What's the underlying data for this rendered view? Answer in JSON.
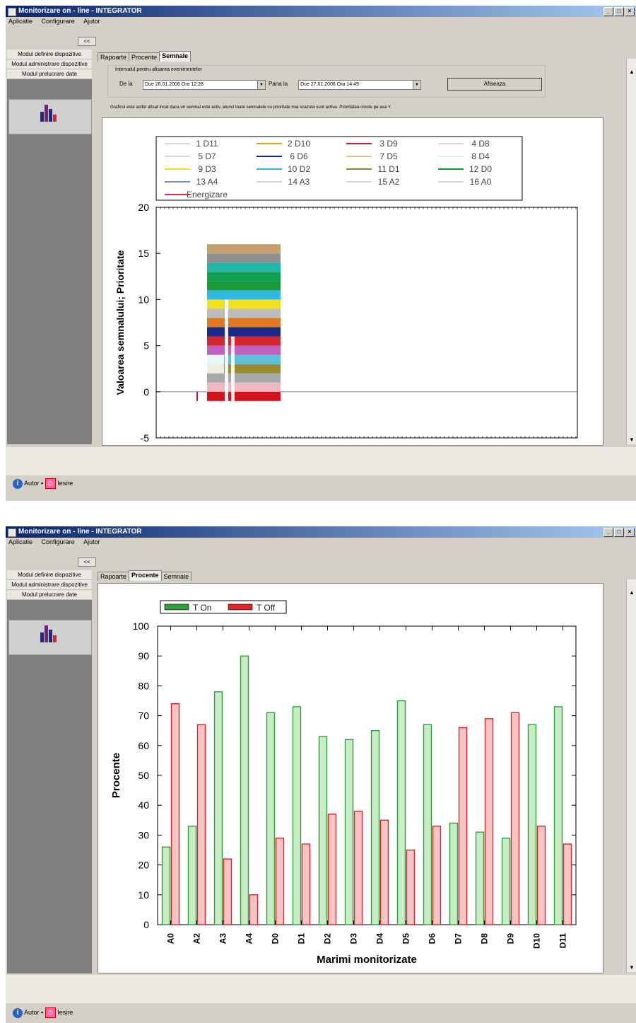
{
  "window": {
    "title": "Monitorizare on - line - INTEGRATOR",
    "menu": [
      "Aplicatie",
      "Configurare",
      "Ajutor"
    ],
    "collapse_label": "<<"
  },
  "sidebar": {
    "items": [
      "Modul definire dispozitive",
      "Modul administrare dispozitive",
      "Modul prelucrare date"
    ]
  },
  "tabs": [
    "Rapoarte",
    "Procente",
    "Semnale"
  ],
  "statusbar": {
    "help_label": "Autor",
    "exit_label": "Iesire"
  },
  "screen1": {
    "active_tab": "Semnale",
    "filter": {
      "group_label": "Intervalul pentru afisarea evenimentelor",
      "from_label": "De la",
      "from_value": "Due 26.01.2006 Ora 12:28",
      "to_label": "Pana la",
      "to_value": "Due 27.01.2006 Ora 14:49",
      "button_label": "Afiseaza"
    },
    "note": "Graficul este astfel afisat incat daca un semnal este activ, atunci toate semnalele cu prioritate mai scazuta sunt active. Prioritatea creste pe axa Y."
  },
  "screen2": {
    "active_tab": "Procente"
  },
  "colors": {
    "title_start": "#0a246a",
    "title_end": "#a6caf0",
    "on": "#2e9e3e",
    "off": "#d8262b"
  },
  "chart_data": [
    {
      "type": "bar",
      "ylabel": "Valoarea semnalului; Prioritate",
      "ylim": [
        -5,
        20
      ],
      "yticks": [
        -5,
        0,
        5,
        10,
        15,
        20
      ],
      "legend": [
        {
          "name": "1 D11",
          "color": "#d8d8d8"
        },
        {
          "name": "2 D10",
          "color": "#e8a020"
        },
        {
          "name": "3 D9",
          "color": "#d02040"
        },
        {
          "name": "4 D8",
          "color": "#d8d8d8"
        },
        {
          "name": "5 D7",
          "color": "#d8d8d8"
        },
        {
          "name": "6 D6",
          "color": "#1c2a8a"
        },
        {
          "name": "7 D5",
          "color": "#f0c080"
        },
        {
          "name": "8 D4",
          "color": "#e8e8e8"
        },
        {
          "name": "9 D3",
          "color": "#f0e020"
        },
        {
          "name": "10 D2",
          "color": "#30b8e0"
        },
        {
          "name": "11 D1",
          "color": "#8a8a30"
        },
        {
          "name": "12 D0",
          "color": "#10a030"
        },
        {
          "name": "13 A4",
          "color": "#7090d0"
        },
        {
          "name": "14 A3",
          "color": "#d8d8d8"
        },
        {
          "name": "15 A2",
          "color": "#d8d8d8"
        },
        {
          "name": "16 A0",
          "color": "#d8d8d8"
        },
        {
          "name": "Energizare",
          "color": "#e03040"
        }
      ],
      "stack_bands": [
        {
          "y0": -1,
          "y1": 0,
          "color": "#d0141e"
        },
        {
          "y0": 0,
          "y1": 1,
          "color": "#f0b8c0"
        },
        {
          "y0": 1,
          "y1": 2,
          "color": "#a8a8a8"
        },
        {
          "y0": 2,
          "y1": 3,
          "color": "#9a8a30"
        },
        {
          "y0": 3,
          "y1": 4,
          "color": "#5ec0d8"
        },
        {
          "y0": 4,
          "y1": 5,
          "color": "#c060c0"
        },
        {
          "y0": 5,
          "y1": 6,
          "color": "#d0282e"
        },
        {
          "y0": 6,
          "y1": 7,
          "color": "#1c2a8a"
        },
        {
          "y0": 7,
          "y1": 8,
          "color": "#e07820"
        },
        {
          "y0": 8,
          "y1": 9,
          "color": "#bdbdbd"
        },
        {
          "y0": 9,
          "y1": 10,
          "color": "#f0e020"
        },
        {
          "y0": 10,
          "y1": 11,
          "color": "#30b8e0"
        },
        {
          "y0": 11,
          "y1": 12,
          "color": "#1c9a3a"
        },
        {
          "y0": 12,
          "y1": 13,
          "color": "#10a050"
        },
        {
          "y0": 13,
          "y1": 14,
          "color": "#20b8a8"
        },
        {
          "y0": 14,
          "y1": 15,
          "color": "#909090"
        },
        {
          "y0": 15,
          "y1": 16,
          "color": "#c8a070"
        }
      ]
    },
    {
      "type": "bar",
      "xlabel": "Marimi monitorizate",
      "ylabel": "Procente",
      "ylim": [
        0,
        100
      ],
      "yticks": [
        0,
        10,
        20,
        30,
        40,
        50,
        60,
        70,
        80,
        90,
        100
      ],
      "legend_position": "top-left",
      "categories": [
        "A0",
        "A2",
        "A3",
        "A4",
        "D0",
        "D1",
        "D2",
        "D3",
        "D4",
        "D5",
        "D6",
        "D7",
        "D8",
        "D9",
        "D10",
        "D11"
      ],
      "series": [
        {
          "name": "T On",
          "color": "#2e9e3e",
          "values": [
            26,
            33,
            78,
            90,
            71,
            73,
            63,
            62,
            65,
            75,
            67,
            34,
            31,
            29,
            67,
            73
          ]
        },
        {
          "name": "T Off",
          "color": "#d8262b",
          "values": [
            74,
            67,
            22,
            10,
            29,
            27,
            37,
            38,
            35,
            25,
            33,
            66,
            69,
            71,
            33,
            27
          ]
        }
      ]
    }
  ]
}
